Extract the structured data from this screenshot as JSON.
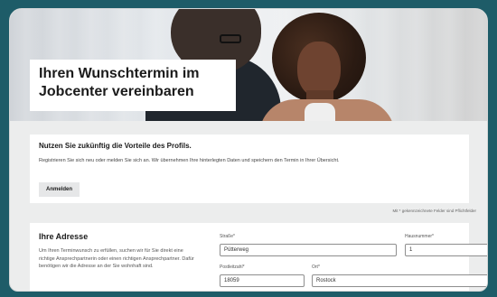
{
  "hero": {
    "title": "Ihren Wunschtermin im Jobcenter vereinbaren"
  },
  "profile": {
    "heading": "Nutzen Sie zukünftig die Vorteile des Profils.",
    "text": "Registrieren Sie sich neu oder melden Sie sich an. Wir übernehmen Ihre hinterlegten Daten und speichern den Termin in Ihrer Übersicht.",
    "login_label": "Anmelden"
  },
  "required_note": "Mit * gekennzeichnete Felder sind Pflichtfelder",
  "address": {
    "heading": "Ihre Adresse",
    "text": "Um Ihren Terminwunsch zu erfüllen, suchen wir für Sie direkt eine richtige Ansprechpartnerin oder einen richtigen Ansprechpartner. Dafür benötigen wir die Adresse an der Sie wohnhaft sind.",
    "fields": {
      "street": {
        "label": "Straße*",
        "value": "Pütterweg"
      },
      "house_number": {
        "label": "Hausnummer*",
        "value": "1"
      },
      "postal_code": {
        "label": "Postleitzahl*",
        "value": "18059"
      },
      "city": {
        "label": "Ort*",
        "value": "Rostock"
      }
    }
  },
  "colors": {
    "frame": "#1e5c68",
    "page_background": "#eceded",
    "panel": "#ffffff",
    "button": "#e6e7e8"
  }
}
